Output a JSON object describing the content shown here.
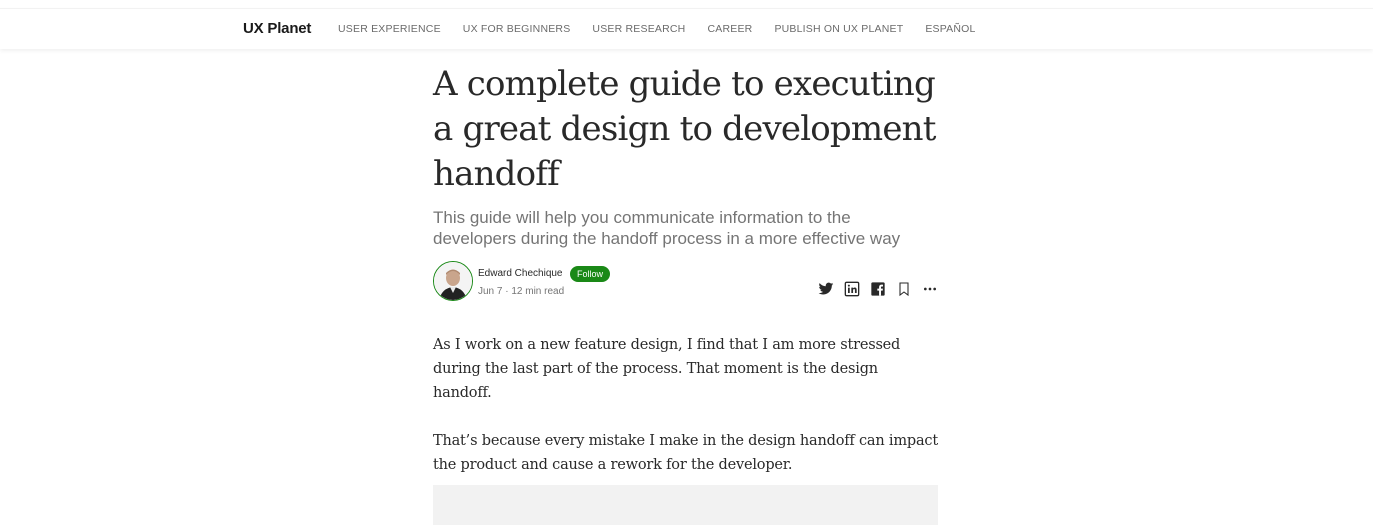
{
  "nav": {
    "brand": "UX Planet",
    "links": [
      "USER EXPERIENCE",
      "UX FOR BEGINNERS",
      "USER RESEARCH",
      "CAREER",
      "PUBLISH ON UX PLANET",
      "ESPAÑOL"
    ]
  },
  "article": {
    "title": "A complete guide to executing a great design to development handoff",
    "subtitle": "This guide will help you communicate information to the developers during the handoff process in a more effective way",
    "author": {
      "name": "Edward Chechique",
      "follow_label": "Follow",
      "meta": "Jun 7 · 12 min read"
    },
    "share_icons": [
      "twitter-icon",
      "linkedin-icon",
      "facebook-icon",
      "bookmark-icon",
      "more-icon"
    ],
    "paragraphs": [
      "As I work on a new feature design, I find that I am more stressed during the last part of the process. That moment is the design handoff.",
      "That’s because every mistake I make in the design handoff can impact the product and cause a rework for the developer."
    ]
  },
  "colors": {
    "accent": "#1a8917",
    "text": "#292929",
    "muted": "#757575"
  }
}
